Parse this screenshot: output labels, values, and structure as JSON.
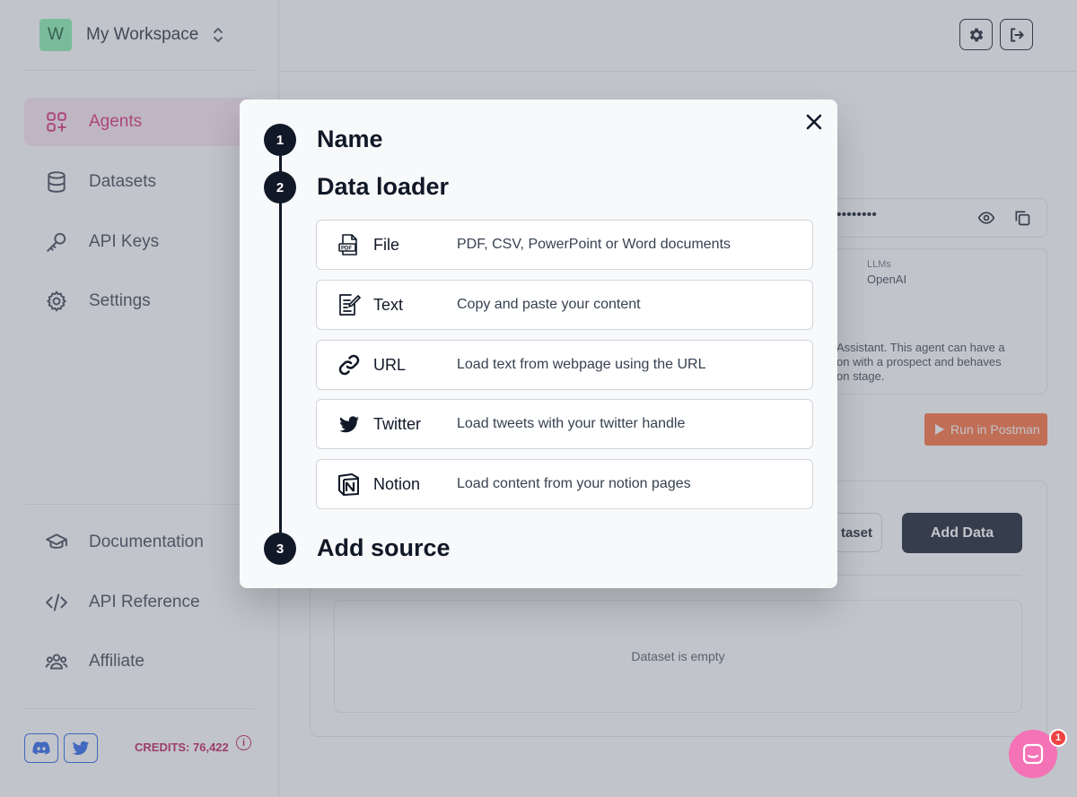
{
  "workspace": {
    "initial": "W",
    "name": "My Workspace"
  },
  "sidebar": {
    "nav": [
      {
        "label": "Agents",
        "icon": "grid-plus-icon"
      },
      {
        "label": "Datasets",
        "icon": "database-icon"
      },
      {
        "label": "API Keys",
        "icon": "key-icon"
      },
      {
        "label": "Settings",
        "icon": "gear-icon"
      }
    ],
    "bottom": [
      {
        "label": "Documentation",
        "icon": "graduation-cap-icon"
      },
      {
        "label": "API Reference",
        "icon": "code-icon"
      },
      {
        "label": "Affiliate",
        "icon": "users-icon"
      }
    ],
    "credits": "CREDITS: 76,422",
    "credits_info": "i"
  },
  "background": {
    "api_key_masked": "••••••••",
    "llms_label": "LLMs",
    "llms_value": "OpenAI",
    "desc_line1": "Assistant. This agent can have a",
    "desc_line2": "on with a prospect and behaves",
    "desc_line3": "on stage.",
    "run_postman": "Run in Postman",
    "dataset_btn": "taset",
    "add_data": "Add Data",
    "empty": "Dataset is empty"
  },
  "modal": {
    "steps": [
      {
        "num": "1",
        "title": "Name"
      },
      {
        "num": "2",
        "title": "Data loader"
      },
      {
        "num": "3",
        "title": "Add source"
      }
    ],
    "loaders": [
      {
        "name": "File",
        "desc": "PDF, CSV, PowerPoint or Word documents",
        "icon": "pdf-file-icon"
      },
      {
        "name": "Text",
        "desc": "Copy and paste your content",
        "icon": "edit-document-icon"
      },
      {
        "name": "URL",
        "desc": "Load text from webpage using the URL",
        "icon": "link-icon"
      },
      {
        "name": "Twitter",
        "desc": "Load tweets with your twitter handle",
        "icon": "twitter-icon"
      },
      {
        "name": "Notion",
        "desc": "Load content from your notion pages",
        "icon": "notion-icon"
      }
    ]
  },
  "chat": {
    "badge": "1"
  },
  "colors": {
    "accent": "#db2777",
    "dark": "#111827",
    "postman": "#ff6c37",
    "workspace_avatar": "#86efac"
  }
}
